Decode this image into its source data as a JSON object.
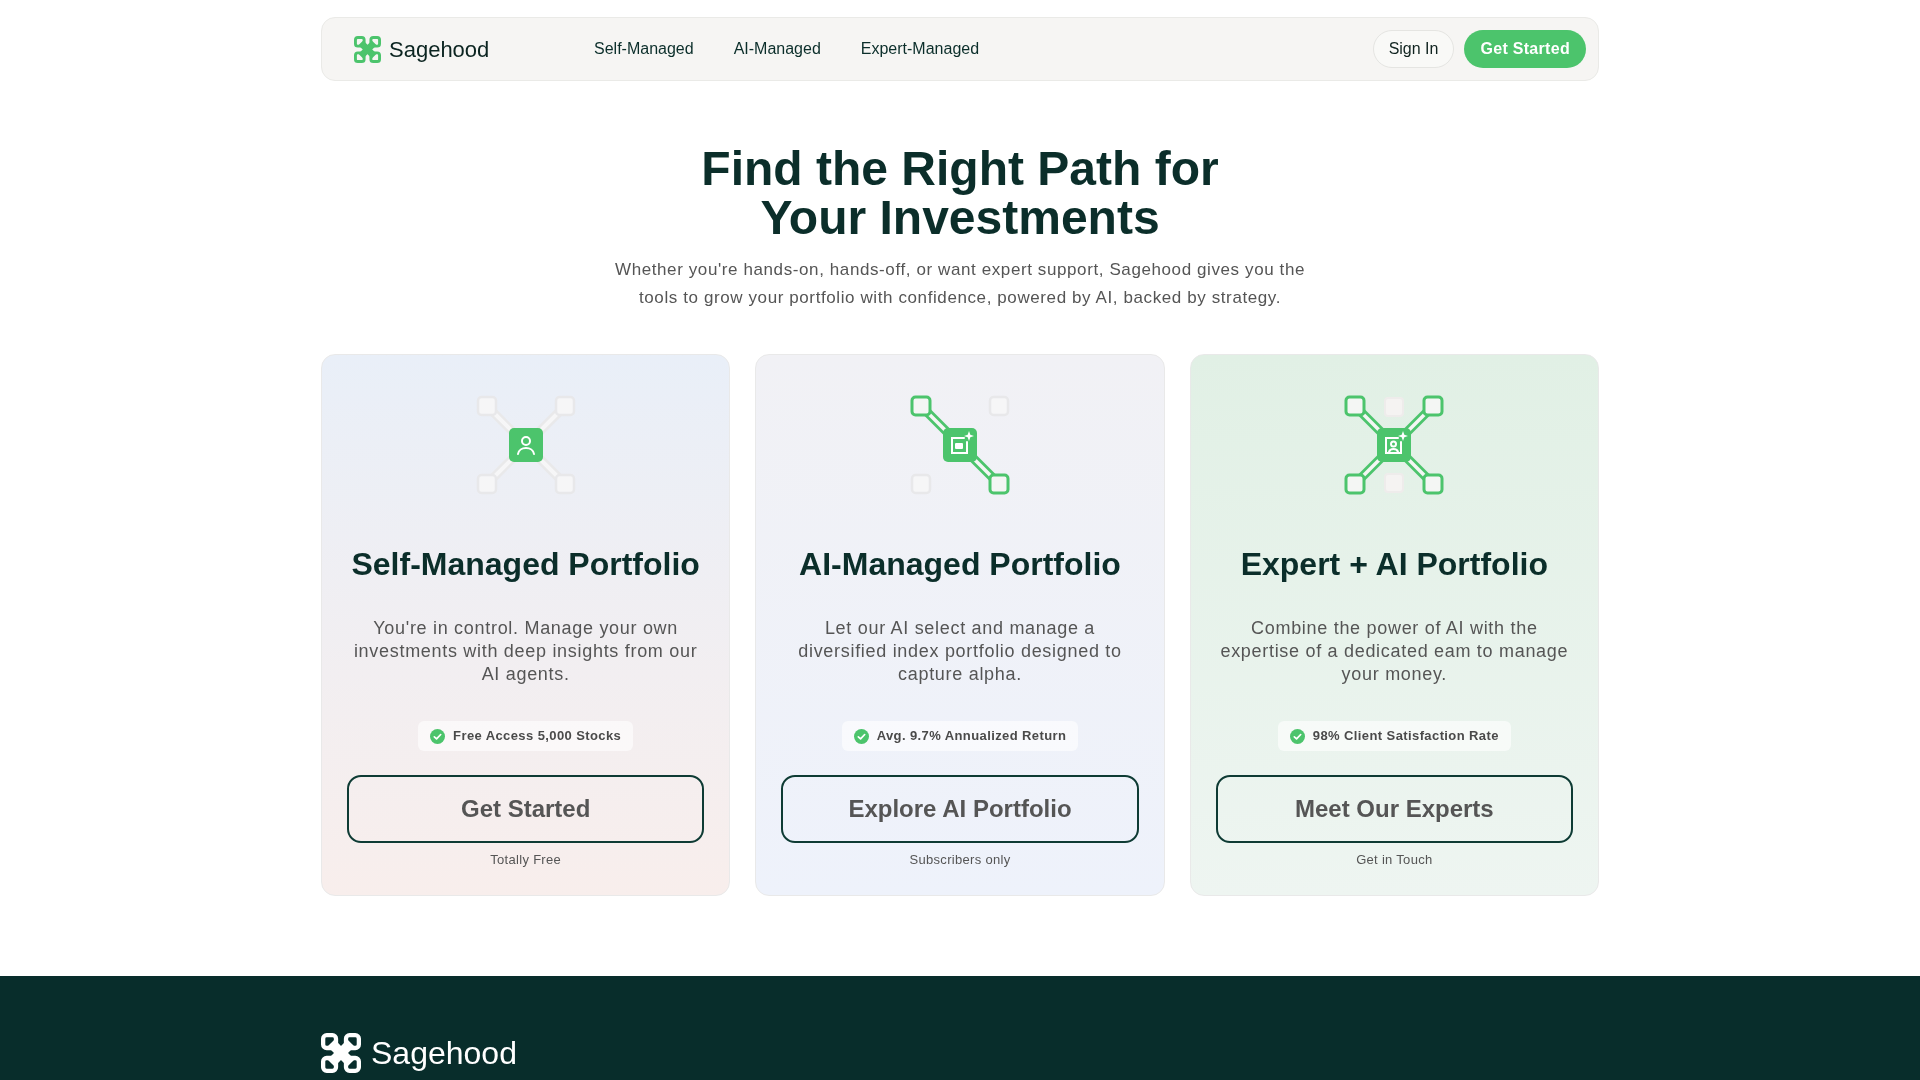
{
  "nav": {
    "brand": "Sagehood",
    "links": [
      "Self-Managed",
      "AI-Managed",
      "Expert-Managed"
    ],
    "sign_in": "Sign In",
    "get_started": "Get Started"
  },
  "hero": {
    "title": "Find the Right Path for Your Investments",
    "subtitle": "Whether you're hands-on, hands-off, or want expert support, Sagehood gives you the tools to grow your portfolio with confidence, powered by AI, backed by strategy."
  },
  "cards": [
    {
      "kind": "self",
      "title": "Self-Managed Portfolio",
      "description": "You're in control. Manage your own investments with deep insights from our AI agents.",
      "badge": "Free Access 5,000 Stocks",
      "button": "Get Started",
      "note": "Totally Free"
    },
    {
      "kind": "ai",
      "title": "AI-Managed Portfolio",
      "description": "Let our AI select and manage a diversified index portfolio designed to capture alpha.",
      "badge": "Avg. 9.7% Annualized Return",
      "button": "Explore AI Portfolio",
      "note": "Subscribers only"
    },
    {
      "kind": "hybrid",
      "title": "Expert + AI Portfolio",
      "description": "Combine the power of AI with the expertise of a dedicated eam to manage your money.",
      "badge": "98% Client Satisfaction Rate",
      "button": "Meet Our Experts",
      "note": "Get in Touch"
    }
  ],
  "footer": {
    "brand": "Sagehood"
  }
}
